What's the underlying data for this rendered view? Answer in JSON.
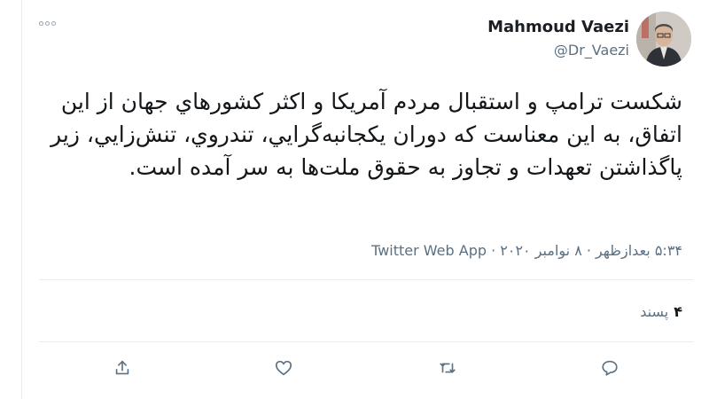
{
  "author": {
    "name": "Mahmoud Vaezi",
    "handle": "@Dr_Vaezi"
  },
  "tweet": {
    "text": "شکست ترامپ و استقبال مردم آمریکا و اکثر کشورهاي جهان از این اتفاق، به این معناست که دوران یکجانبه‌گرایي، تندروي، تنش‌زایي، زیر پاگذاشتن تعهدات و تجاوز به حقوق ملت‌ها به سر آمده است.",
    "meta": "۵:۳۴ بعدازظهر · ۸ نوامبر ۲۰۲۰ · Twitter Web App"
  },
  "stats": {
    "likes_count": "۴",
    "likes_label": "پسند"
  },
  "icons": {
    "more": "more-options-icon",
    "share": "share-icon",
    "like": "heart-icon",
    "retweet": "retweet-icon",
    "reply": "reply-icon"
  }
}
